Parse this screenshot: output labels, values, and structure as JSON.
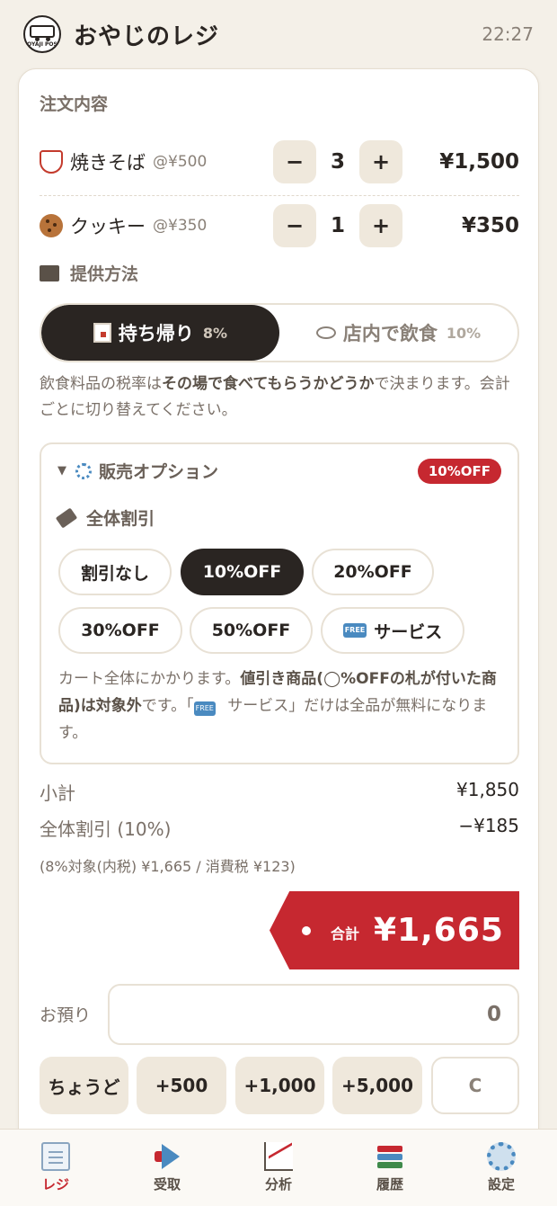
{
  "header": {
    "logo_text": "OYAJI POS",
    "title": "おやじのレジ",
    "time": "22:27"
  },
  "order": {
    "section_label": "注文内容",
    "items": [
      {
        "icon": "yakisoba-bowl-icon",
        "name": "焼きそば",
        "unit_price": "@¥500",
        "qty": "3",
        "total": "¥1,500"
      },
      {
        "icon": "cookie-icon",
        "name": "クッキー",
        "unit_price": "@¥350",
        "qty": "1",
        "total": "¥350"
      }
    ],
    "minus_label": "−",
    "plus_label": "+"
  },
  "service": {
    "section_label": "提供方法",
    "options": [
      {
        "label": "持ち帰り",
        "rate": "8%",
        "selected": true
      },
      {
        "label": "店内で飲食",
        "rate": "10%",
        "selected": false
      }
    ],
    "note_pre": "飲食料品の税率は",
    "note_bold": "その場で食べてもらうかどうか",
    "note_post": "で決まります。会計ごとに切り替えてください。"
  },
  "sales_options": {
    "title": "販売オプション",
    "badge": "10%OFF",
    "discount_label": "全体割引",
    "chips": [
      {
        "label": "割引なし",
        "selected": false
      },
      {
        "label": "10%OFF",
        "selected": true
      },
      {
        "label": "20%OFF",
        "selected": false
      },
      {
        "label": "30%OFF",
        "selected": false
      },
      {
        "label": "50%OFF",
        "selected": false
      },
      {
        "label": "サービス",
        "selected": false
      }
    ],
    "free_icon_text": "FREE",
    "note_pre": "カート全体にかかります。",
    "note_bold": "値引き商品(◯%OFFの札が付いた商品)は対象外",
    "note_mid": "です。「",
    "note_free": "FREE",
    "note_post": " サービス」だけは全品が無料になります。"
  },
  "totals": {
    "subtotal_label": "小計",
    "subtotal_value": "¥1,850",
    "discount_label": "全体割引 (10%)",
    "discount_value": "−¥185",
    "tax_line": "(8%対象(内税) ¥1,665 / 消費税 ¥123)",
    "total_label": "合計",
    "total_value": "¥1,665"
  },
  "payment": {
    "label": "お預り",
    "value": "0",
    "quick": [
      "ちょうど",
      "+500",
      "+1,000",
      "+5,000",
      "C"
    ]
  },
  "nav": {
    "items": [
      {
        "label": "レジ",
        "icon": "receipt-icon",
        "active": true
      },
      {
        "label": "受取",
        "icon": "megaphone-icon",
        "active": false
      },
      {
        "label": "分析",
        "icon": "chart-icon",
        "active": false
      },
      {
        "label": "履歴",
        "icon": "books-icon",
        "active": false
      },
      {
        "label": "設定",
        "icon": "gear-icon",
        "active": false
      }
    ]
  },
  "colors": {
    "accent": "#c62830",
    "dark": "#2a2522",
    "background": "#f4f0e8"
  }
}
